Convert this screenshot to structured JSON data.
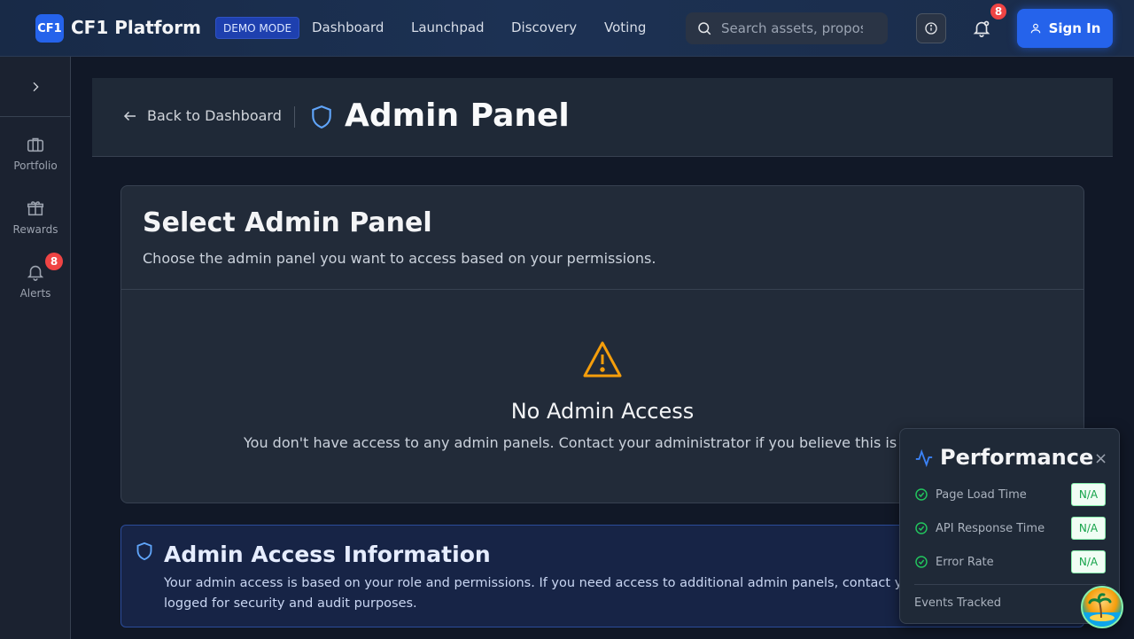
{
  "header": {
    "logo_badge": "CF1",
    "brand": "CF1 Platform",
    "mode_badge": "DEMO MODE",
    "nav": [
      "Dashboard",
      "Launchpad",
      "Discovery",
      "Voting"
    ],
    "search_placeholder": "Search assets, proposals...",
    "notification_count": "8",
    "sign_in": "Sign In"
  },
  "sidebar": {
    "items": [
      {
        "label": "Portfolio",
        "icon": "briefcase-icon"
      },
      {
        "label": "Rewards",
        "icon": "gift-icon"
      },
      {
        "label": "Alerts",
        "icon": "bell-icon",
        "badge": "8"
      }
    ]
  },
  "page": {
    "back_label": "Back to Dashboard",
    "title": "Admin Panel"
  },
  "select_card": {
    "title": "Select Admin Panel",
    "subtitle": "Choose the admin panel you want to access based on your permissions.",
    "empty_title": "No Admin Access",
    "empty_text": "You don't have access to any admin panels. Contact your administrator if you believe this is"
  },
  "info_card": {
    "title": "Admin Access Information",
    "text": "Your admin access is based on your role and permissions. If you need access to additional admin panels, contact your admin actions are logged for security and audit purposes."
  },
  "performance": {
    "title": "Performance",
    "close": "×",
    "metrics": [
      {
        "label": "Page Load Time",
        "value": "N/A"
      },
      {
        "label": "API Response Time",
        "value": "N/A"
      },
      {
        "label": "Error Rate",
        "value": "N/A"
      }
    ],
    "events_label": "Events Tracked"
  },
  "colors": {
    "accent": "#2563eb",
    "warning": "#f59e0b",
    "success": "#16a34a",
    "danger": "#ef4444"
  }
}
